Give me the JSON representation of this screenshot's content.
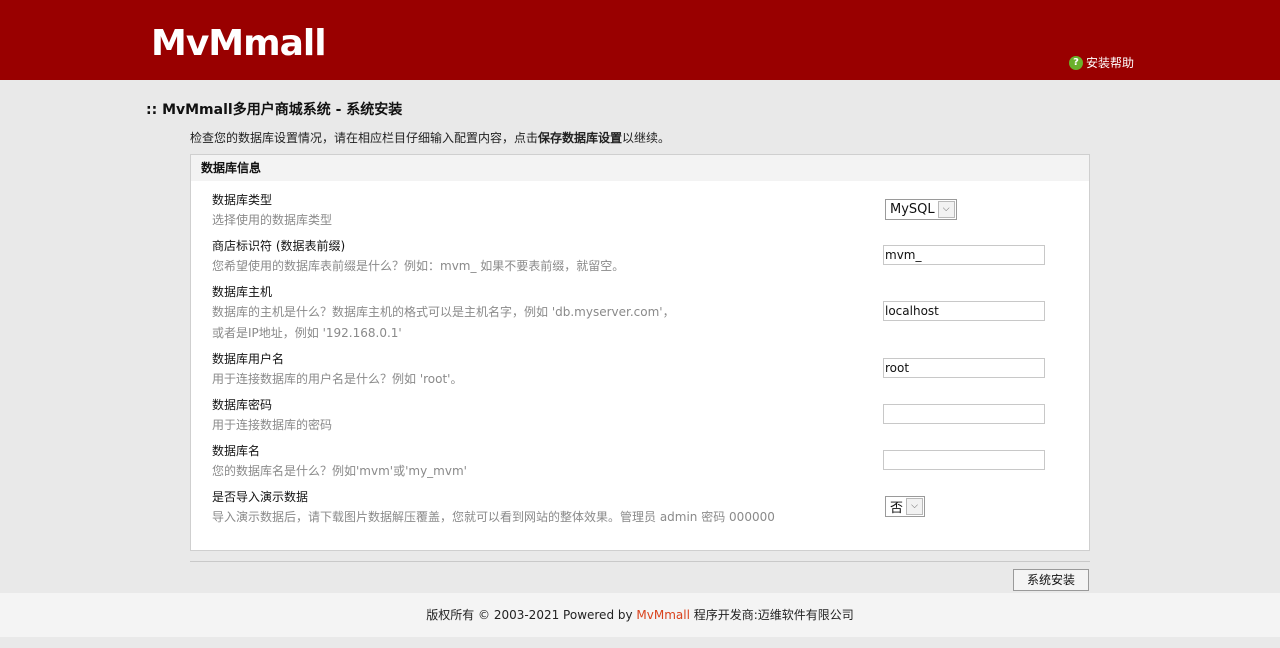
{
  "header": {
    "logo": "MvMmall",
    "help_link": "安装帮助",
    "help_icon": "question-circle-icon",
    "bg_color": "#990000"
  },
  "page": {
    "title": ":: MvMmall多用户商城系统 - 系统安装",
    "intro_prefix": "检查您的数据库设置情况，请在相应栏目仔细输入配置内容，点击",
    "intro_bold": "保存数据库设置",
    "intro_suffix": "以继续。"
  },
  "panel": {
    "title": "数据库信息",
    "rows": [
      {
        "label": "数据库类型",
        "desc": "选择使用的数据库类型",
        "select": "MySQL"
      },
      {
        "label": "商店标识符 (数据表前缀)",
        "desc": "您希望使用的数据库表前缀是什么？例如：mvm_ 如果不要表前缀，就留空。",
        "value": "mvm_"
      },
      {
        "label": "数据库主机",
        "desc": "数据库的主机是什么？数据库主机的格式可以是主机名字，例如 'db.myserver.com'，",
        "desc2": "或者是IP地址，例如 '192.168.0.1'",
        "value": "localhost"
      },
      {
        "label": "数据库用户名",
        "desc": "用于连接数据库的用户名是什么？例如 'root'。",
        "value": "root"
      },
      {
        "label": "数据库密码",
        "desc": "用于连接数据库的密码",
        "value": ""
      },
      {
        "label": "数据库名",
        "desc": "您的数据库名是什么？例如'mvm'或'my_mvm'",
        "value": ""
      },
      {
        "label": "是否导入演示数据",
        "desc": "导入演示数据后，请下载图片数据解压覆盖，您就可以看到网站的整体效果。管理员 admin 密码 000000",
        "select": "否"
      }
    ]
  },
  "actions": {
    "install_button": "系统安装"
  },
  "footer": {
    "prefix": "版权所有 © 2003-2021 Powered by ",
    "brand": "MvMmall",
    "suffix": " 程序开发商:迈维软件有限公司"
  }
}
